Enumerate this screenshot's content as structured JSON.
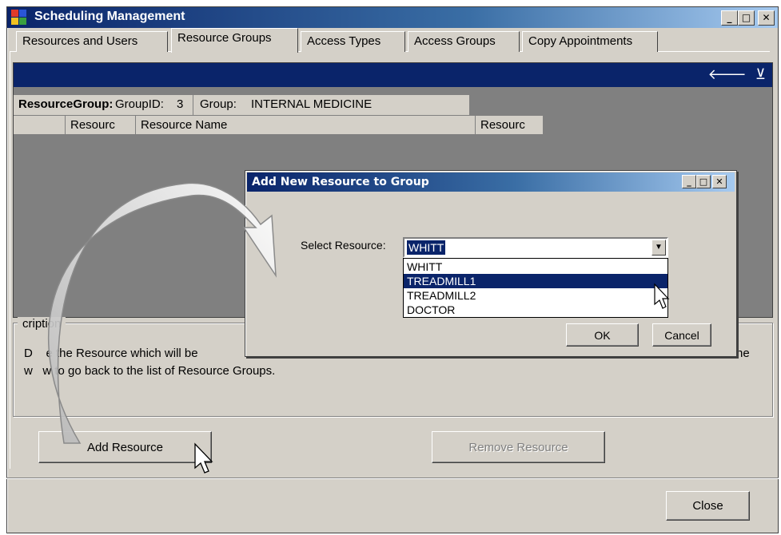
{
  "window": {
    "title": "Scheduling Management",
    "controls": [
      "_",
      "□",
      "✕"
    ]
  },
  "tabs": [
    {
      "label": "Resources and Users",
      "active": false
    },
    {
      "label": "Resource Groups",
      "active": true
    },
    {
      "label": "Access Types",
      "active": false
    },
    {
      "label": "Access Groups",
      "active": false
    },
    {
      "label": "Copy Appointments",
      "active": false
    }
  ],
  "grid": {
    "caption_icons": [
      "back-arrow-icon",
      "collapse-icon"
    ],
    "parent_row": {
      "label": "ResourceGroup:",
      "group_id_label": "GroupID:",
      "group_id": "3",
      "group_label": "Group:",
      "group_name": "INTERNAL MEDICINE"
    },
    "columns": [
      "Resourc",
      "Resource Name",
      "Resourc"
    ]
  },
  "description": {
    "legend": "cription",
    "line1": "D    e the Resource which will be",
    "line1_tail": "ne",
    "line2": "w   w to go back to the list of Resource Groups."
  },
  "buttons": {
    "add_resource": "Add Resource",
    "remove_resource": "Remove Resource",
    "close": "Close"
  },
  "dialog": {
    "title": "Add New Resource to Group",
    "controls": [
      "_",
      "□",
      "✕"
    ],
    "select_label": "Select Resource:",
    "selected_value": "WHITT",
    "options": [
      "WHITT",
      "TREADMILL1",
      "TREADMILL2",
      "DOCTOR"
    ],
    "highlighted_option": "TREADMILL1",
    "ok": "OK",
    "cancel": "Cancel"
  },
  "colors": {
    "titlebar_dark": "#0a246a",
    "titlebar_light": "#a6caf0",
    "face": "#d4d0c8",
    "grid_bg": "#808080",
    "selection": "#0a246a"
  }
}
